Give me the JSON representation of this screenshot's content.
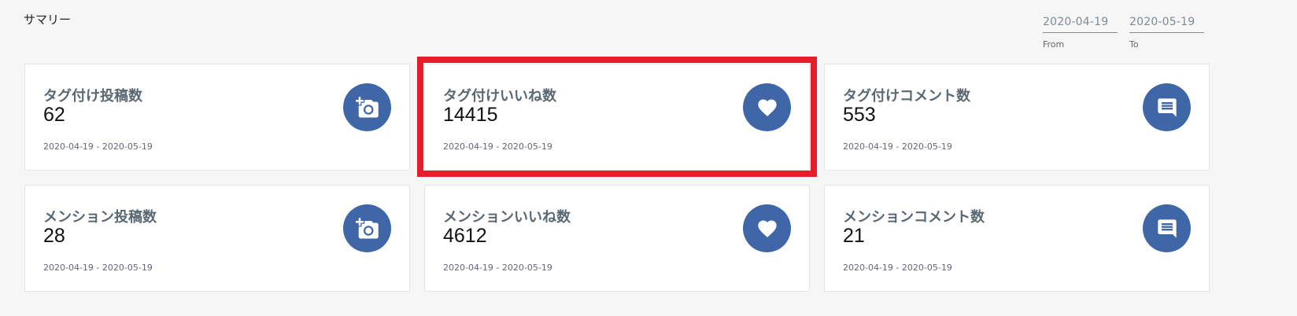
{
  "summary": {
    "title": "サマリー"
  },
  "date_range": {
    "from_value": "2020-04-19",
    "from_label": "From",
    "to_value": "2020-05-19",
    "to_label": "To"
  },
  "cards": [
    {
      "label": "タグ付け投稿数",
      "value": "62",
      "range": "2020-04-19 - 2020-05-19",
      "icon": "add-photo-icon"
    },
    {
      "label": "タグ付けいいね数",
      "value": "14415",
      "range": "2020-04-19 - 2020-05-19",
      "icon": "heart-icon"
    },
    {
      "label": "タグ付けコメント数",
      "value": "553",
      "range": "2020-04-19 - 2020-05-19",
      "icon": "comment-icon"
    },
    {
      "label": "メンション投稿数",
      "value": "28",
      "range": "2020-04-19 - 2020-05-19",
      "icon": "add-photo-icon"
    },
    {
      "label": "メンションいいね数",
      "value": "4612",
      "range": "2020-04-19 - 2020-05-19",
      "icon": "heart-icon"
    },
    {
      "label": "メンションコメント数",
      "value": "21",
      "range": "2020-04-19 - 2020-05-19",
      "icon": "comment-icon"
    }
  ],
  "colors": {
    "icon_bg": "#3f67a7",
    "highlight": "#e61e2b"
  }
}
